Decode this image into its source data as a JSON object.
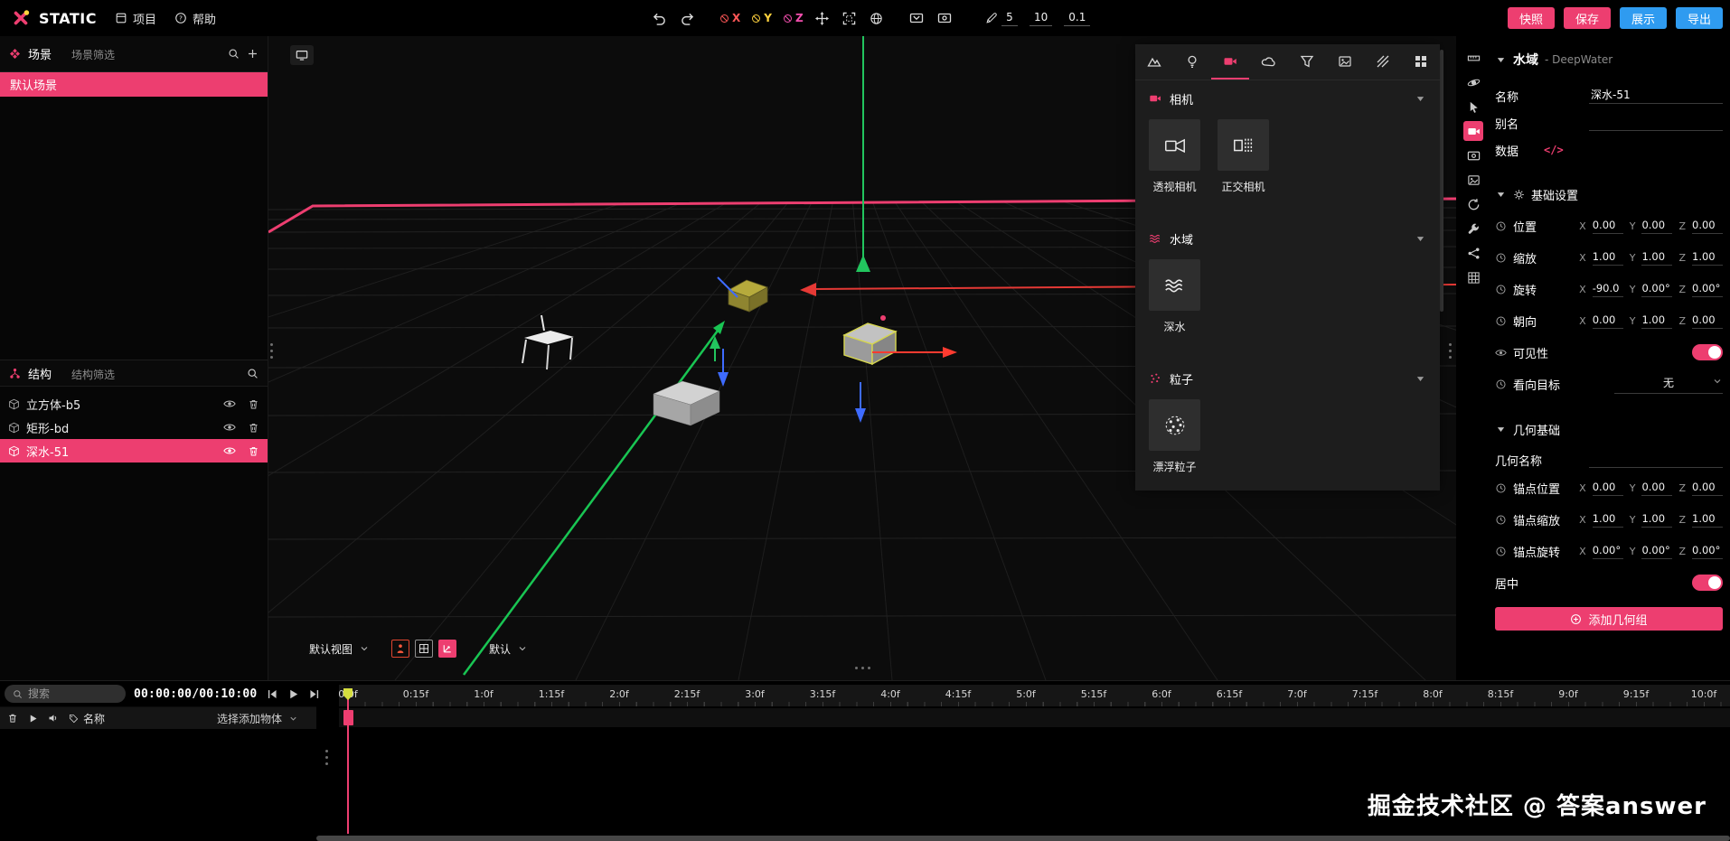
{
  "colors": {
    "accent": "#ed3e70",
    "blue": "#2f9bf0",
    "playhead": "#d6de3f"
  },
  "topbar": {
    "app_name": "STATIC",
    "menu_project": "项目",
    "menu_help": "帮助",
    "axis_x": "X",
    "axis_y": "Y",
    "axis_z": "Z",
    "snap_move": "5",
    "snap_rotate": "10",
    "snap_scale": "0.1",
    "btn_snapshot": "快照",
    "btn_save": "保存",
    "btn_present": "展示",
    "btn_export": "导出"
  },
  "scene_panel": {
    "title": "场景",
    "filter_placeholder": "场景筛选",
    "items": [
      {
        "label": "默认场景"
      }
    ]
  },
  "structure_panel": {
    "title": "结构",
    "filter_placeholder": "结构筛选",
    "items": [
      {
        "label": "立方体-b5"
      },
      {
        "label": "矩形-bd"
      },
      {
        "label": "深水-51"
      }
    ]
  },
  "viewport": {
    "view_select": "默认视图",
    "preset_select": "默认"
  },
  "library": {
    "camera_section": "相机",
    "camera_items": [
      "透视相机",
      "正交相机"
    ],
    "water_section": "水域",
    "water_items": [
      "深水"
    ],
    "particle_section": "粒子",
    "particle_items": [
      "漂浮粒子"
    ]
  },
  "properties": {
    "type_title": "水域",
    "type_subtitle": "- DeepWater",
    "name_label": "名称",
    "name_value": "深水-51",
    "alias_label": "别名",
    "alias_value": "",
    "data_label": "数据",
    "data_code": "</>",
    "basic_title": "基础设置",
    "axis_x": "X",
    "axis_y": "Y",
    "axis_z": "Z",
    "position": {
      "label": "位置",
      "x": "0.00",
      "y": "0.00",
      "z": "0.00"
    },
    "scale": {
      "label": "缩放",
      "x": "1.00",
      "y": "1.00",
      "z": "1.00"
    },
    "rotation": {
      "label": "旋转",
      "x": "-90.0",
      "y": "0.00°",
      "z": "0.00°"
    },
    "direction": {
      "label": "朝向",
      "x": "0.00",
      "y": "1.00",
      "z": "0.00"
    },
    "visibility_label": "可见性",
    "lookat_label": "看向目标",
    "lookat_value": "无",
    "geometry_title": "几何基础",
    "geo_name_label": "几何名称",
    "geo_name_value": "",
    "anchor_position": {
      "label": "锚点位置",
      "x": "0.00",
      "y": "0.00",
      "z": "0.00"
    },
    "anchor_scale": {
      "label": "锚点缩放",
      "x": "1.00",
      "y": "1.00",
      "z": "1.00"
    },
    "anchor_rotation": {
      "label": "锚点旋转",
      "x": "0.00°",
      "y": "0.00°",
      "z": "0.00°"
    },
    "center_label": "居中",
    "add_group_btn": "添加几何组"
  },
  "timeline": {
    "search_placeholder": "搜索",
    "time_display": "00:00:00/00:10:00",
    "name_label": "名称",
    "add_object_select": "选择添加物体",
    "ticks": [
      "0:0f",
      "0:15f",
      "1:0f",
      "1:15f",
      "2:0f",
      "2:15f",
      "3:0f",
      "3:15f",
      "4:0f",
      "4:15f",
      "5:0f",
      "5:15f",
      "6:0f",
      "6:15f",
      "7:0f",
      "7:15f",
      "8:0f",
      "8:15f",
      "9:0f",
      "9:15f",
      "10:0f"
    ]
  },
  "watermark": "掘金技术社区 @ 答案answer"
}
